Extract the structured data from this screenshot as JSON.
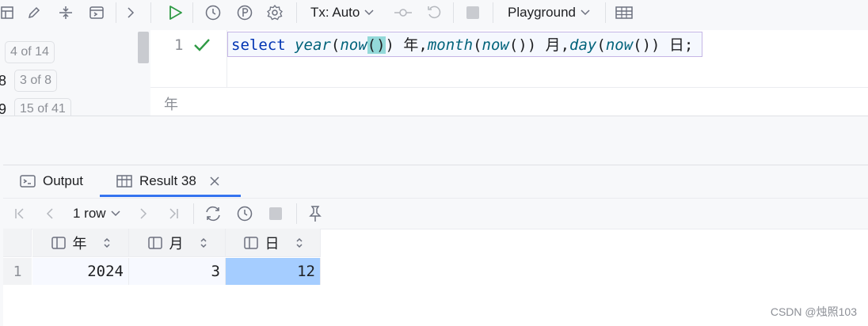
{
  "toolbar": {
    "tx_label": "Tx: Auto",
    "playground_label": "Playground"
  },
  "left_panel": {
    "counters": [
      {
        "digit": "",
        "text": "4 of 14"
      },
      {
        "digit": "8",
        "text": "3 of 8"
      },
      {
        "digit": "9",
        "text": "15 of 41"
      }
    ]
  },
  "editor": {
    "line_number": "1",
    "code": {
      "t1": "select",
      "t2": " ",
      "t3": "year",
      "t4": "(",
      "t5": "now",
      "t6": "()",
      "t7": ") 年,",
      "t8": "month",
      "t9": "(",
      "t10": "now",
      "t11": "()) 月,",
      "t12": "day",
      "t13": "(",
      "t14": "now",
      "t15": "()) 日;"
    },
    "hint": "年"
  },
  "tabs": {
    "output_label": "Output",
    "result_label": "Result 38"
  },
  "result_toolbar": {
    "rows_label": "1 row"
  },
  "grid": {
    "columns": [
      "年",
      "月",
      "日"
    ],
    "row_number": "1",
    "row": [
      "2024",
      "3",
      "12"
    ]
  },
  "watermark": "CSDN @烛照103",
  "colors": {
    "accent": "#3574f0",
    "run_green": "#2e9a44",
    "selected_cell": "#a5cdff"
  }
}
